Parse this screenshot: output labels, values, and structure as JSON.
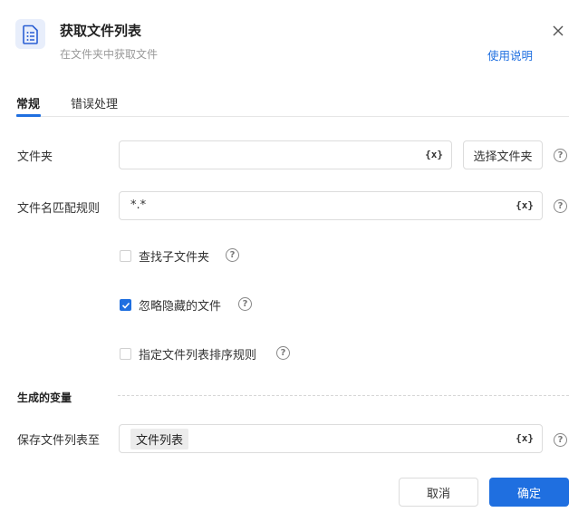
{
  "header": {
    "title": "获取文件列表",
    "subtitle": "在文件夹中获取文件",
    "help_link": "使用说明",
    "icon": "list-document-icon",
    "accent": "#1f6fe0"
  },
  "tabs": [
    {
      "label": "常规",
      "active": true
    },
    {
      "label": "错误处理",
      "active": false
    }
  ],
  "form": {
    "folder": {
      "label": "文件夹",
      "value": "",
      "var_icon": "{x}",
      "select_button": "选择文件夹"
    },
    "pattern": {
      "label": "文件名匹配规则",
      "value": "*.*",
      "var_icon": "{x}"
    },
    "options": [
      {
        "label": "查找子文件夹",
        "checked": false
      },
      {
        "label": "忽略隐藏的文件",
        "checked": true
      },
      {
        "label": "指定文件列表排序规则",
        "checked": false
      }
    ]
  },
  "output": {
    "section_title": "生成的变量",
    "save_label": "保存文件列表至",
    "variable": "文件列表",
    "var_icon": "{x}"
  },
  "footer": {
    "cancel": "取消",
    "ok": "确定"
  },
  "help_glyph": "?"
}
